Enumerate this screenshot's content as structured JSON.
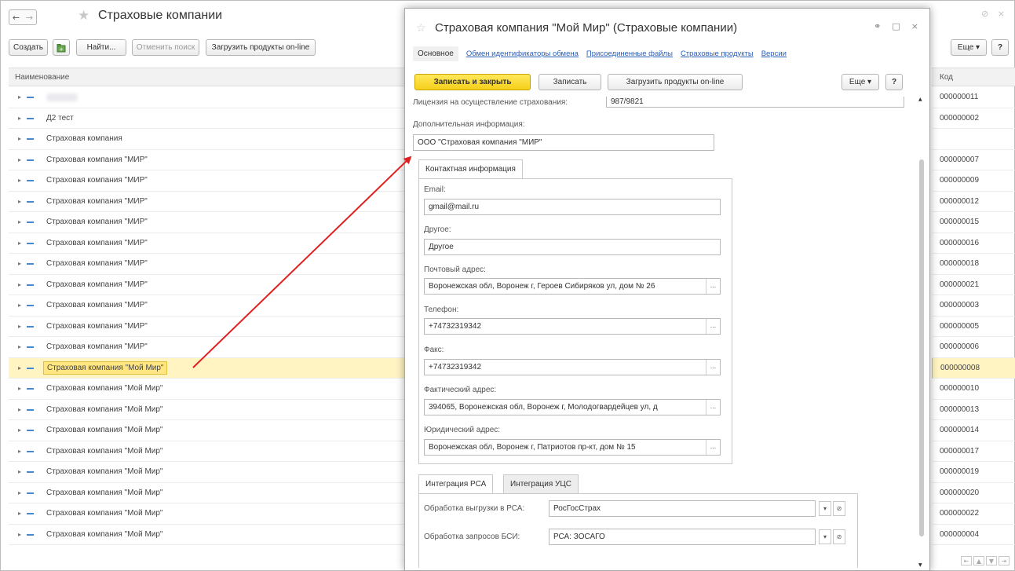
{
  "list_window": {
    "title": "Страховые компании",
    "toolbar": {
      "create": "Создать",
      "find": "Найти...",
      "cancel_search": "Отменить поиск",
      "load_products": "Загрузить продукты on-line",
      "more": "Еще",
      "help": "?"
    },
    "columns": {
      "name": "Наименование",
      "code": "Код"
    },
    "rows": [
      {
        "name": "",
        "code": "000000011"
      },
      {
        "name": "Д2 тест",
        "code": "000000002"
      },
      {
        "name": "Страховая компания",
        "code": ""
      },
      {
        "name": "Страховая компания \"МИР\"",
        "code": "000000007"
      },
      {
        "name": "Страховая компания \"МИР\"",
        "code": "000000009"
      },
      {
        "name": "Страховая компания \"МИР\"",
        "code": "000000012"
      },
      {
        "name": "Страховая компания \"МИР\"",
        "code": "000000015"
      },
      {
        "name": "Страховая компания \"МИР\"",
        "code": "000000016"
      },
      {
        "name": "Страховая компания \"МИР\"",
        "code": "000000018"
      },
      {
        "name": "Страховая компания \"МИР\"",
        "code": "000000021"
      },
      {
        "name": "Страховая компания \"МИР\"",
        "code": "000000003"
      },
      {
        "name": "Страховая компания \"МИР\"",
        "code": "000000005"
      },
      {
        "name": "Страховая компания \"МИР\"",
        "code": "000000006"
      },
      {
        "name": "Страховая компания \"Мой Мир\"",
        "code": "000000008",
        "selected": true
      },
      {
        "name": "Страховая компания \"Мой Мир\"",
        "code": "000000010"
      },
      {
        "name": "Страховая компания \"Мой Мир\"",
        "code": "000000013"
      },
      {
        "name": "Страховая компания \"Мой Мир\"",
        "code": "000000014"
      },
      {
        "name": "Страховая компания \"Мой Мир\"",
        "code": "000000017"
      },
      {
        "name": "Страховая компания \"Мой Мир\"",
        "code": "000000019"
      },
      {
        "name": "Страховая компания \"Мой Мир\"",
        "code": "000000020"
      },
      {
        "name": "Страховая компания \"Мой Мир\"",
        "code": "000000022"
      },
      {
        "name": "Страховая компания \"Мой Мир\"",
        "code": "000000004"
      }
    ]
  },
  "form": {
    "title": "Страховая компания \"Мой Мир\" (Страховые компании)",
    "tabs": {
      "main": "Основное",
      "exchange_ids": "Обмен идентификаторы обмена",
      "attached_files": "Присоединенные файлы",
      "insurance_products": "Страховые продукты",
      "versions": "Версии"
    },
    "toolbar": {
      "save_close": "Записать и закрыть",
      "save": "Записать",
      "load_products": "Загрузить продукты on-line",
      "more": "Еще",
      "help": "?"
    },
    "license_label": "Лицензия на осуществление страхования:",
    "license_value": "987/9821",
    "additional_info_label": "Дополнительная информация:",
    "additional_info_value": "ООО \"Страховая компания \"МИР\"",
    "contact_tab": "Контактная информация",
    "contact": {
      "email_label": "Email:",
      "email_value": "gmail@mail.ru",
      "other_label": "Другое:",
      "other_value": "Другое",
      "postal_label": "Почтовый адрес:",
      "postal_value": "Воронежская обл, Воронеж г, Героев Сибиряков ул, дом № 26",
      "phone_label": "Телефон:",
      "phone_value": "+74732319342",
      "fax_label": "Факс:",
      "fax_value": "+74732319342",
      "actual_label": "Фактический адрес:",
      "actual_value": "394065, Воронежская обл, Воронеж г, Молодогвардейцев ул, д",
      "legal_label": "Юридический адрес:",
      "legal_value": "Воронежская обл, Воронеж г, Патриотов пр-кт, дом № 15",
      "pick": "..."
    },
    "integration_tabs": {
      "rsa": "Интеграция РСА",
      "ucs": "Интеграция УЦС"
    },
    "integration": {
      "rsa_export_label": "Обработка выгрузки в РСА:",
      "rsa_export_value": "РосГосСтрах",
      "bsi_label": "Обработка запросов БСИ:",
      "bsi_value": "РСА: ЗОСАГО"
    }
  },
  "colors": {
    "accent_yellow": "#f5cf1a",
    "link_blue": "#2b5eb7",
    "annotation_red": "#e02020"
  }
}
